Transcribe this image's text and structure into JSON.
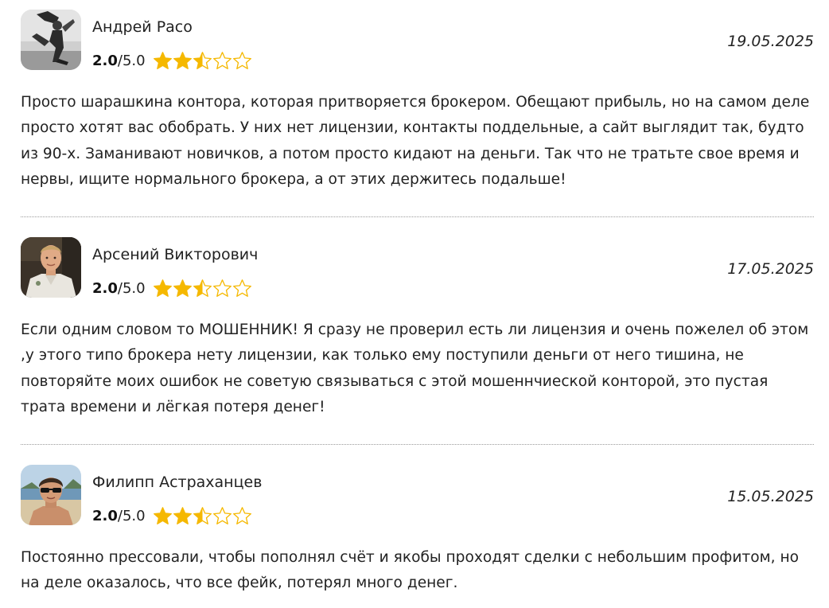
{
  "reviews": [
    {
      "author": "Андрей Расо",
      "score": "2.0",
      "scale": "/5.0",
      "rating_value": 2.5,
      "rating_max": 5,
      "date": "19.05.2025",
      "text": "Просто шарашкина контора, которая притворяется брокером. Обещают прибыль, но на самом деле просто хотят вас обобрать. У них нет лицензии, контакты поддельные, а сайт выглядит так, будто из 90-х. Заманивают новичков, а потом просто кидают на деньги. Так что не тратьте свое время и нервы, ищите нормального брокера, а от этих держитесь подальше!"
    },
    {
      "author": "Арсений Викторович",
      "score": "2.0",
      "scale": "/5.0",
      "rating_value": 2.5,
      "rating_max": 5,
      "date": "17.05.2025",
      "text": "Если одним словом то МОШЕННИК! Я сразу не проверил есть ли лицензия и очень пожелел об этом ,у этого типо брокера нету лицензии, как только ему поступили деньги от него тишина, не повторяйте моих ошибок не советую связываться с этой мошеннчиеской конторой, это пустая трата времени и лёгкая потеря денег!"
    },
    {
      "author": "Филипп Астраханцев",
      "score": "2.0",
      "scale": "/5.0",
      "rating_value": 2.5,
      "rating_max": 5,
      "date": "15.05.2025",
      "text": "Постоянно прессовали, чтобы пополнял счёт и якобы проходят сделки с небольшим профитом, но на деле оказалось, что все фейк, потерял много денег."
    }
  ],
  "colors": {
    "star": "#F5B800",
    "text": "#222222",
    "divider": "#9A9A9A"
  },
  "icons": {
    "filled": "star-filled-icon",
    "half": "star-half-icon",
    "empty": "star-empty-icon"
  }
}
